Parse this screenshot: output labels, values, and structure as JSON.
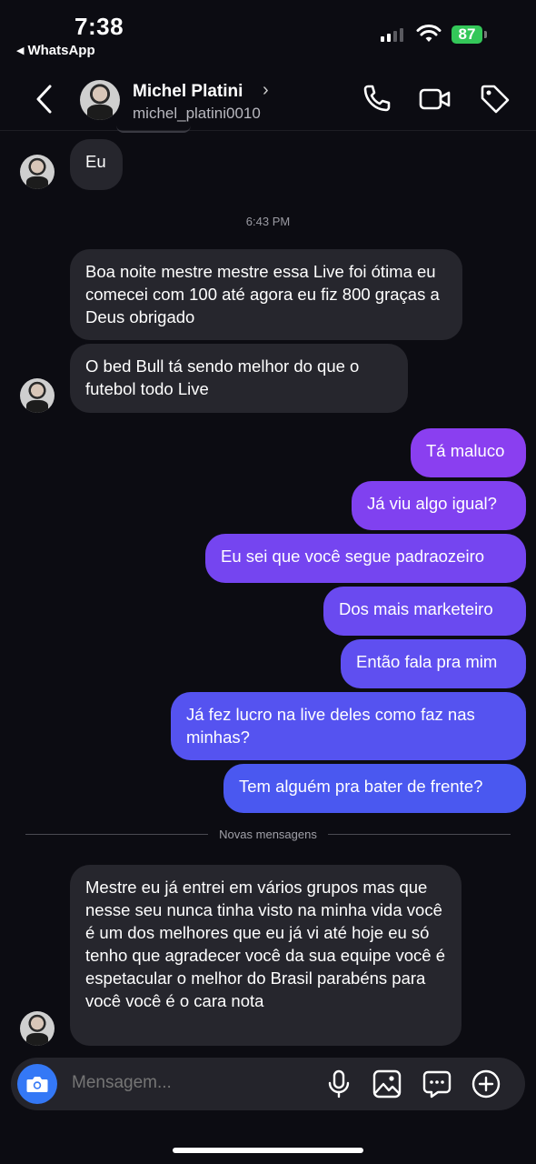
{
  "status": {
    "time": "7:38",
    "back_app": "WhatsApp",
    "battery": "87"
  },
  "header": {
    "name": "Michel Platini",
    "username": "michel_platini0010"
  },
  "chat": {
    "timestamp": "6:43 PM",
    "divider_label": "Novas mensagens",
    "messages": [
      {
        "dir": "in",
        "text": "Eu"
      },
      {
        "dir": "in",
        "text": "Boa noite mestre mestre essa Live foi ótima eu comecei com 100 até agora eu fiz 800 graças a Deus obrigado"
      },
      {
        "dir": "in",
        "text": "O bed Bull tá sendo melhor do que o futebol todo Live"
      },
      {
        "dir": "out",
        "text": "Tá maluco"
      },
      {
        "dir": "out",
        "text": "Já viu algo igual?"
      },
      {
        "dir": "out",
        "text": "Eu sei que você segue padraozeiro"
      },
      {
        "dir": "out",
        "text": "Dos mais marketeiro"
      },
      {
        "dir": "out",
        "text": "Então fala pra mim"
      },
      {
        "dir": "out",
        "text": "Já fez lucro na live deles como faz nas minhas?"
      },
      {
        "dir": "out",
        "text": "Tem alguém pra bater de frente?"
      },
      {
        "dir": "in",
        "text": "Mestre eu já entrei em vários grupos mas que nesse seu nunca tinha visto na minha vida você é um dos melhores que eu já vi até hoje eu só tenho que agradecer você da sua equipe você é espetacular o melhor do Brasil parabéns para você você é o cara nota"
      }
    ]
  },
  "composer": {
    "placeholder": "Mensagem..."
  },
  "colors": {
    "incoming": "#26262d",
    "outgoing_top": "#8b3ff0",
    "outgoing_bottom": "#3f5ff0",
    "accent": "#3478f6"
  }
}
